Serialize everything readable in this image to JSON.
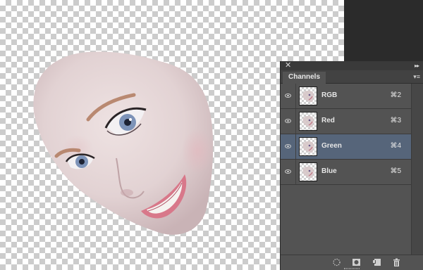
{
  "panel": {
    "tab_title": "Channels",
    "close_glyph": "✕",
    "collapse_glyph": "▸▸",
    "menu_glyph": "▾≡"
  },
  "channels": [
    {
      "name": "RGB",
      "shortcut": "⌘2",
      "visible": true,
      "selected": false
    },
    {
      "name": "Red",
      "shortcut": "⌘3",
      "visible": true,
      "selected": false
    },
    {
      "name": "Green",
      "shortcut": "⌘4",
      "visible": true,
      "selected": true
    },
    {
      "name": "Blue",
      "shortcut": "⌘5",
      "visible": true,
      "selected": false
    }
  ],
  "bottom_icons": [
    "load-selection-icon",
    "save-selection-icon",
    "new-channel-icon",
    "trash-icon"
  ],
  "colors": {
    "selected_row": "#56657a",
    "panel_bg": "#535353",
    "skin": "#e3d4d4",
    "lips": "#d8788a",
    "iris": "#7d93b8"
  }
}
